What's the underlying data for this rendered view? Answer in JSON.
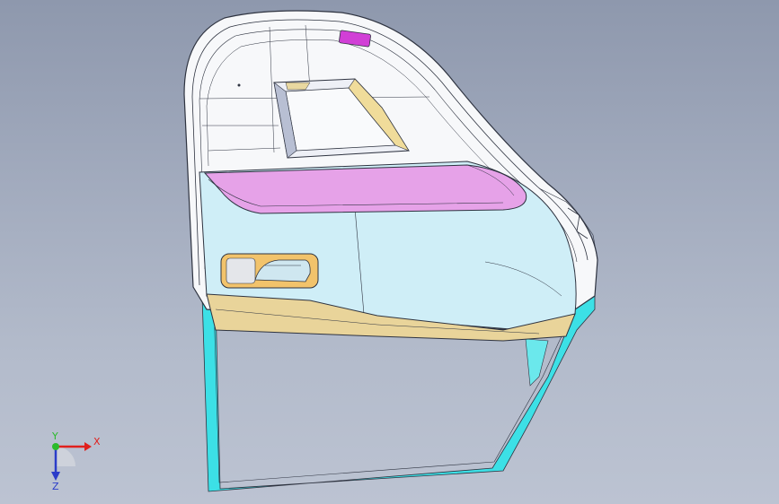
{
  "viewport": {
    "background_top": "#8e98ad",
    "background_bottom": "#bcc3d2"
  },
  "model": {
    "part_colors": {
      "trim_panel_top": "#f7f8fa",
      "armrest": "#e6a2e8",
      "lower_panel": "#cfeef7",
      "map_pocket": "#e9d49a",
      "handle_bezel": "#f2c36b",
      "door_frame": "#3ce0e6",
      "clip": "#d13fd6",
      "edges": "#2e3340"
    }
  },
  "triad": {
    "x_label": "X",
    "y_label": "Y",
    "z_label": "Z",
    "x_color": "#e0201d",
    "y_color": "#2bbb2b",
    "z_color": "#2a3cc9"
  }
}
